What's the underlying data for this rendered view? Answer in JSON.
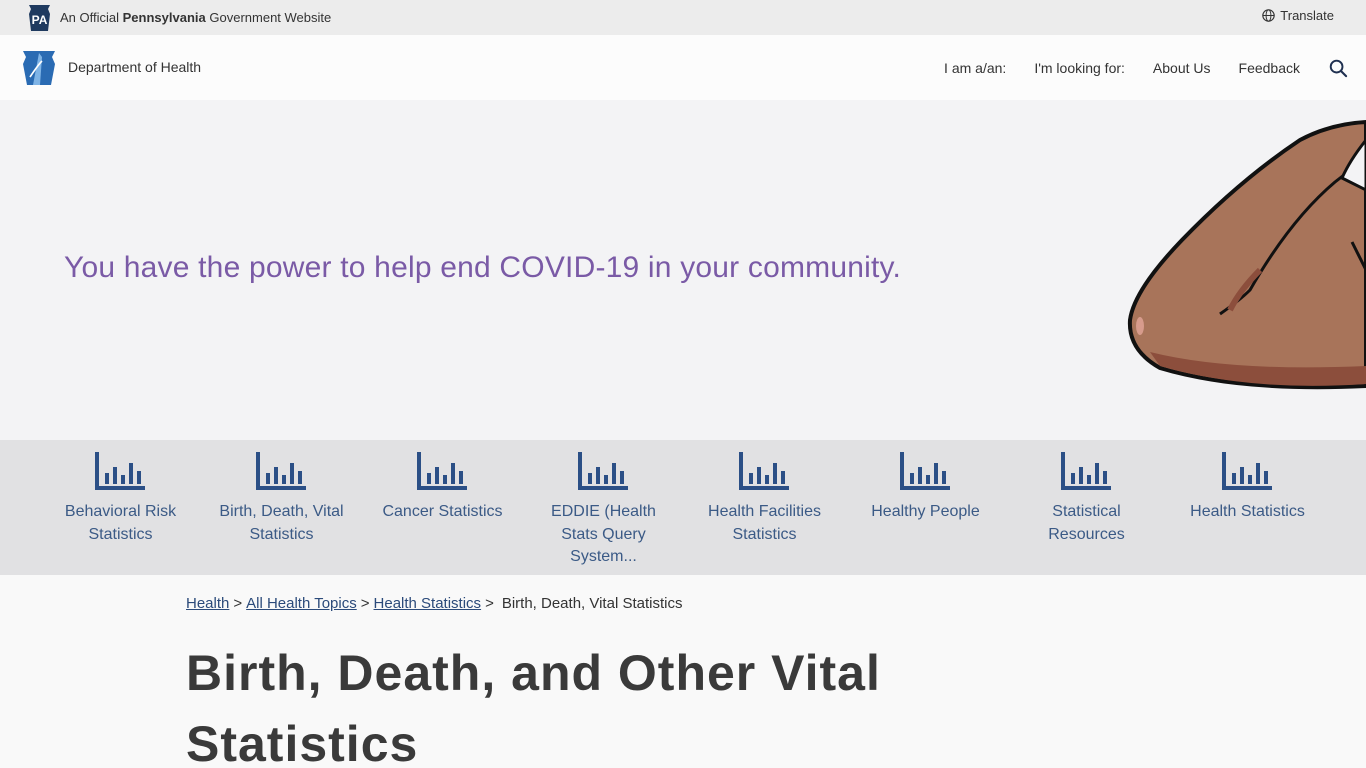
{
  "official_bar": {
    "badge_text": "PA",
    "text_prefix": "An Official",
    "text_state": "Pennsylvania",
    "text_suffix": "Government Website",
    "translate_label": "Translate"
  },
  "header": {
    "dept_name": "Department of Health",
    "nav": [
      {
        "label": "I am a/an:"
      },
      {
        "label": "I'm looking for:"
      },
      {
        "label": "About Us"
      },
      {
        "label": "Feedback"
      }
    ]
  },
  "hero": {
    "text": "You have the power to help end COVID-19 in your community."
  },
  "stat_tiles": [
    {
      "label": "Behavioral Risk Statistics",
      "icon": "bar-chart-icon"
    },
    {
      "label": "Birth, Death, Vital Statistics",
      "icon": "bar-chart-icon"
    },
    {
      "label": "Cancer Statistics",
      "icon": "bar-chart-icon"
    },
    {
      "label": "EDDIE (Health Stats Query System...",
      "icon": "bar-chart-icon"
    },
    {
      "label": "Health Facilities Statistics",
      "icon": "bar-chart-icon"
    },
    {
      "label": "Healthy People",
      "icon": "bar-chart-icon"
    },
    {
      "label": "Statistical Resources",
      "icon": "bar-chart-icon"
    },
    {
      "label": "Health Statistics",
      "icon": "bar-chart-icon"
    }
  ],
  "breadcrumb": {
    "links": [
      "Health",
      "All Health Topics",
      "Health Statistics"
    ],
    "current": "Birth, Death, Vital Statistics"
  },
  "page_title": "Birth, Death, and Other Vital Statistics",
  "colors": {
    "hero_text": "#7a5aa6",
    "icon_blue": "#2b4f86",
    "link_blue": "#2b4a7a"
  }
}
